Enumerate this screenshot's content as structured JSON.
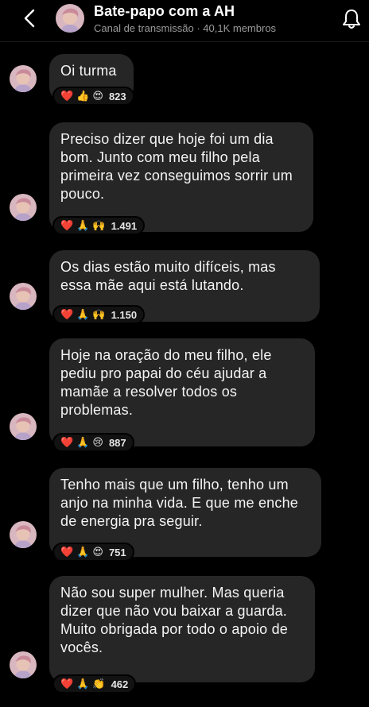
{
  "header": {
    "title": "Bate-papo com a AH",
    "subtitle": "Canal de transmissão · 40,1K membros"
  },
  "colors": {
    "bubble": "#262626",
    "background": "#000000",
    "subtitle": "#9a9a9a"
  },
  "messages": [
    {
      "text": "Oi turma",
      "reactions": [
        "❤️",
        "👍",
        "😍"
      ],
      "count": "823"
    },
    {
      "text": "Preciso dizer que hoje foi um dia bom. Junto com meu filho pela primeira vez conseguimos sorrir um pouco.",
      "reactions": [
        "❤️",
        "🙏",
        "🙌"
      ],
      "count": "1.491"
    },
    {
      "text": "Os dias estão muito difíceis, mas essa mãe aqui está lutando.",
      "reactions": [
        "❤️",
        "🙏",
        "🙌"
      ],
      "count": "1.150"
    },
    {
      "text": "Hoje na oração do meu filho, ele pediu pro papai do céu ajudar a mamãe a resolver todos os problemas.",
      "reactions": [
        "❤️",
        "🙏",
        "😢"
      ],
      "count": "887"
    },
    {
      "text": "Tenho mais que um filho, tenho um anjo na minha vida. E que me enche de energia pra seguir.",
      "reactions": [
        "❤️",
        "🙏",
        "😍"
      ],
      "count": "751"
    },
    {
      "text": "Não sou super mulher. Mas queria dizer que não vou baixar a guarda. Muito obrigada por todo o apoio de vocês.",
      "reactions": [
        "❤️",
        "🙏",
        "👏"
      ],
      "count": "462"
    }
  ]
}
